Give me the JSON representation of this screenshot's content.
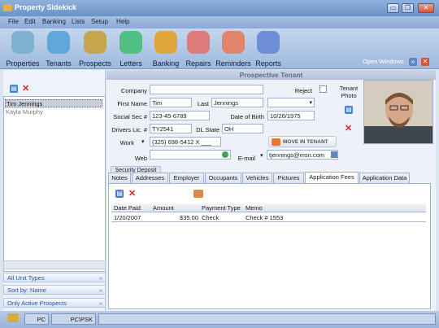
{
  "window": {
    "title": "Property Sidekick",
    "min": "▭",
    "max": "❐",
    "close": "✕"
  },
  "menu": [
    "File",
    "Edit",
    "Banking",
    "Lists",
    "Setup",
    "Help"
  ],
  "toolbar": [
    {
      "label": "Properties",
      "icon": "properties-icon",
      "color": "#7fb2d0"
    },
    {
      "label": "Tenants",
      "icon": "tenants-icon",
      "color": "#5fa8dc"
    },
    {
      "label": "Prospects",
      "icon": "prospects-icon",
      "color": "#c4a64c"
    },
    {
      "label": "Letters",
      "icon": "letters-icon",
      "color": "#4fbf84"
    },
    {
      "label": "Banking",
      "icon": "banking-icon",
      "color": "#e1a63b"
    },
    {
      "label": "Repairs",
      "icon": "repairs-icon",
      "color": "#dd7a7a"
    },
    {
      "label": "Reminders",
      "icon": "reminders-icon",
      "color": "#e0846b"
    },
    {
      "label": "Reports",
      "icon": "reports-icon",
      "color": "#6d8fd8"
    }
  ],
  "open_windows": "Open Windows",
  "header": "Prospective Tenant",
  "prospects": [
    "Tim Jennings",
    "Kayla Murphy"
  ],
  "filters": [
    "All Unit Types",
    "Sort by: Name",
    "Only Active Prospects"
  ],
  "form": {
    "company_label": "Company",
    "company": "",
    "reject_label": "Reject",
    "first_label": "First Name",
    "first": "Tim",
    "last_label": "Last",
    "last": "Jennings",
    "ssn_label": "Social Sec #",
    "ssn": "123-45-6789",
    "dob_label": "Date of Birth",
    "dob": "10/26/1975",
    "dl_label": "Drivers Lic. #",
    "dl": "TY2541",
    "dlstate_label": "DL State",
    "dlstate": "OH",
    "work_label": "Work",
    "work": "(325) 698-5412 X ___",
    "movein": "MOVE IN TENANT",
    "web_label": "Web",
    "web": "",
    "email_label": "E-mail",
    "email": "tjennings@msn.com",
    "photo_label": "Tenant Photo"
  },
  "security_deposit": "Security Deposit",
  "tabs": [
    "Notes",
    "Addresses",
    "Employer",
    "Occupants",
    "Vehicles",
    "Pictures",
    "Application Fees",
    "Application Data"
  ],
  "active_tab": "Application Fees",
  "fees": {
    "columns": [
      "Date Paid",
      "Amount",
      "Payment Type",
      "Memo"
    ],
    "rows": [
      {
        "date": "1/20/2007",
        "amount": "$35.00",
        "type": "Check",
        "memo": "Check # 1553"
      }
    ]
  },
  "status": {
    "cell1": "PC",
    "cell2": "PC\\PSK"
  },
  "colors": {
    "accent": "#6b93c8",
    "delete": "#d12b2b",
    "doc": "#3d7ed6"
  }
}
